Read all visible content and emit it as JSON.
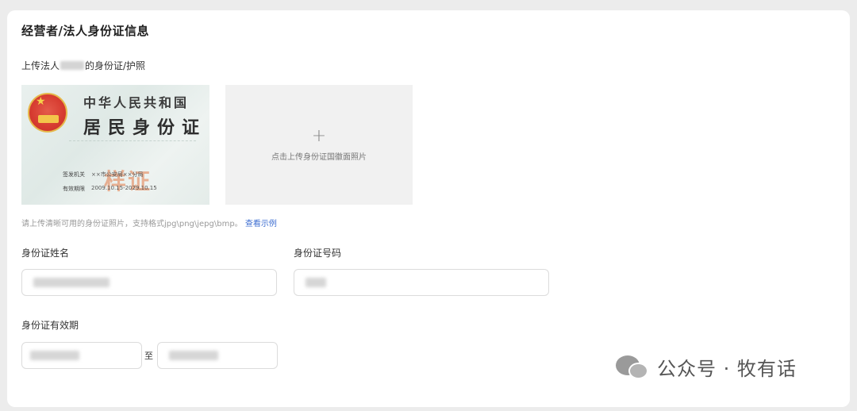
{
  "section": {
    "title": "经营者/法人身份证信息",
    "upload_label_prefix": "上传法人",
    "upload_label_suffix": "的身份证/护照"
  },
  "id_card_sample": {
    "line1": "中华人民共和国",
    "line2": "居民身份证",
    "stamp": "样证",
    "issuer_label": "签发机关",
    "issuer_value": "××市公安局××分局",
    "validity_label": "有效期限",
    "validity_value": "2009.10.15-2029.10.15"
  },
  "upload_box": {
    "plus": "+",
    "hint": "点击上传身份证国徽面照片"
  },
  "tip": {
    "text": "请上传清晰可用的身份证照片，支持格式jpg\\png\\jepg\\bmp。",
    "link": "查看示例"
  },
  "fields": {
    "name_label": "身份证姓名",
    "number_label": "身份证号码",
    "validity_label": "身份证有效期",
    "to_separator": "至"
  },
  "watermark": {
    "text": "公众号 · 牧有话",
    "icon": "wechat-icon"
  }
}
